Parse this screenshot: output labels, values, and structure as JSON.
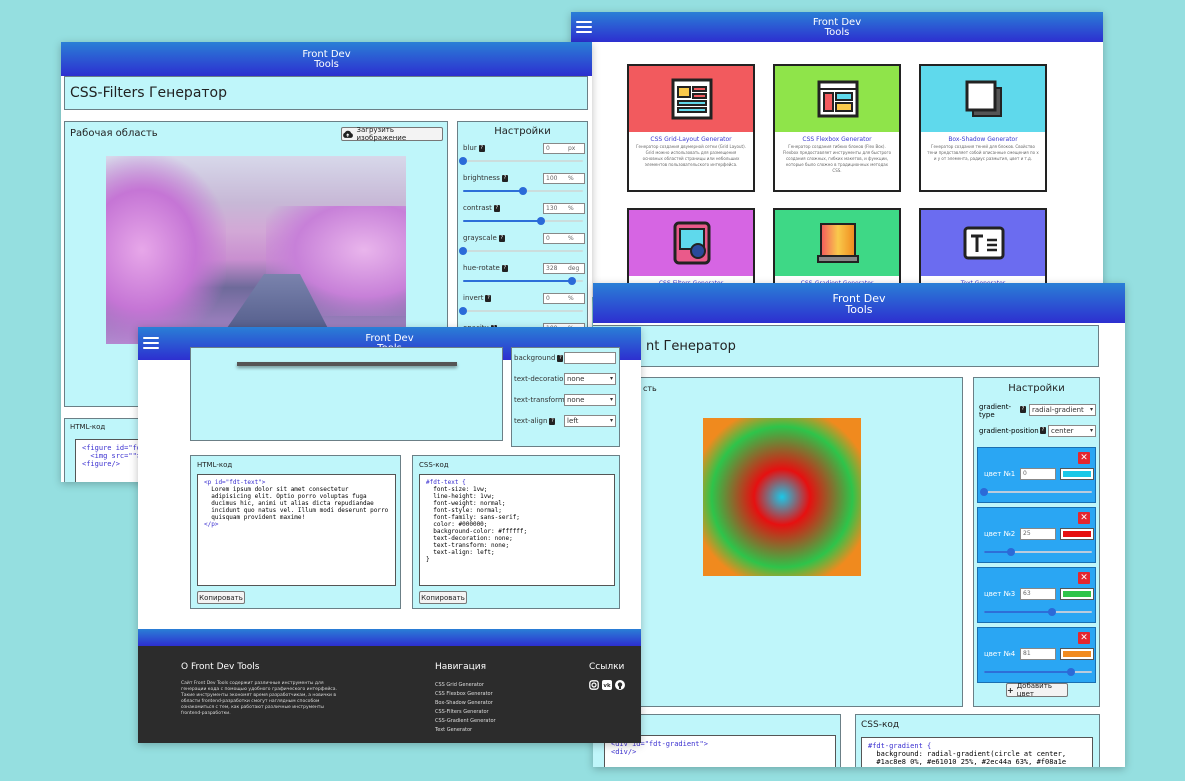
{
  "brand": {
    "line1": "Front Dev",
    "line2": "Tools"
  },
  "filters_window": {
    "page_title": "CSS-Filters Генератор",
    "work_area_label": "Рабочая область",
    "upload_button": "Загрузить изображение",
    "settings_title": "Настройки",
    "settings": [
      {
        "label": "blur",
        "value": "0",
        "unit": "px",
        "fraction": 0.0
      },
      {
        "label": "brightness",
        "value": "100",
        "unit": "%",
        "fraction": 0.5
      },
      {
        "label": "contrast",
        "value": "130",
        "unit": "%",
        "fraction": 0.65
      },
      {
        "label": "grayscale",
        "value": "0",
        "unit": "%",
        "fraction": 0.0
      },
      {
        "label": "hue-rotate",
        "value": "328",
        "unit": "deg",
        "fraction": 0.91
      },
      {
        "label": "invert",
        "value": "0",
        "unit": "%",
        "fraction": 0.0
      },
      {
        "label": "opacity",
        "value": "100",
        "unit": "%",
        "fraction": 1.0
      }
    ],
    "html_label": "HTML-код",
    "html_code": [
      "<figure id=\"fdt",
      "  <img src=\"\">",
      "<figure/>"
    ]
  },
  "home_window": {
    "cards": [
      {
        "title": "CSS Grid-Layout Generator",
        "desc": "Генератор создания двумерной сетки (Grid Layout). Grid можно использовать для размещения основных областей страницы или небольших элементов пользовательского интерфейса.",
        "color": "#f25a5e",
        "icon": "grid-layout-icon"
      },
      {
        "title": "CSS Flexbox Generator",
        "desc": "Генератор создания гибких блоков (Flex Box). Flexbox предоставляет инструменты для быстрого создания сложных, гибких макетов, и функции, которые было сложно в традиционных методах CSS.",
        "color": "#8fe44a",
        "icon": "flexbox-icon"
      },
      {
        "title": "Box-Shadow Generator",
        "desc": "Генератор создания теней для блоков. Свойство тени представляет собой описанные смещения по x и y от элемента, радиус размытия, цвет и т.д.",
        "color": "#5fd9ec",
        "icon": "box-shadow-icon"
      },
      {
        "title": "CSS-Filters Generator",
        "desc": "",
        "color": "#d665e3",
        "icon": "filters-icon"
      },
      {
        "title": "CSS-Gradient Generator",
        "desc": "",
        "color": "#3ed886",
        "icon": "gradient-icon"
      },
      {
        "title": "Text Generator",
        "desc": "",
        "color": "#6b6cf0",
        "icon": "text-icon"
      }
    ]
  },
  "text_window": {
    "settings": [
      {
        "label": "background",
        "value": ""
      },
      {
        "label": "text-decoration",
        "value": "none"
      },
      {
        "label": "text-transform",
        "value": "none"
      },
      {
        "label": "text-align",
        "value": "left"
      }
    ],
    "html_label": "HTML-код",
    "html_code": [
      "<p id=\"fdt-text\">",
      "  Lorem ipsum dolor sit amet consectetur",
      "  adipisicing elit. Optio porro voluptas fuga",
      "  ducimus hic, animi ut alias dicta repudiandae",
      "  incidunt quo natus vel. Illum modi deserunt porro",
      "  quisquam provident maxime!",
      "</p>"
    ],
    "css_label": "CSS-код",
    "css_code": [
      "#fdt-text {",
      "  font-size: 1vw;",
      "  line-height: 1vw;",
      "  font-weight: normal;",
      "  font-style: normal;",
      "  font-family: sans-serif;",
      "  color: #000000;",
      "  background-color: #ffffff;",
      "  text-decoration: none;",
      "  text-transform: none;",
      "  text-align: left;",
      "}"
    ],
    "copy_button": "Копировать",
    "footer": {
      "about_title": "О Front Dev Tools",
      "about_text": "Сайт Front Dev Tools содержит различные инструменты для генерации кода с помощью удобного графического интерфейса. Такие инструменты экономят время разработчикам, а новички в области frontend-разработки смогут наглядным способом ознакомиться с тем, как работают различные инструменты frontend-разработки.",
      "nav_title": "Навигация",
      "nav_items": [
        "CSS Grid Generator",
        "CSS Flexbox Generator",
        "Box-Shadow Generator",
        "CSS-Filters Generator",
        "CSS-Gradient Generator",
        "Text Generator"
      ],
      "links_title": "Ссылки"
    }
  },
  "gradient_window": {
    "page_title": "nt Генератор",
    "work_area_label": "сть",
    "settings_title": "Настройки",
    "gradient_type_label": "gradient-type",
    "gradient_type_value": "radial-gradient",
    "gradient_position_label": "gradient-position",
    "gradient_position_value": "center",
    "colors": [
      {
        "label": "цвет №1",
        "value": "0",
        "color": "#1ac8e8",
        "fraction": 0.0
      },
      {
        "label": "цвет №2",
        "value": "25",
        "color": "#e61010",
        "fraction": 0.25
      },
      {
        "label": "цвет №3",
        "value": "63",
        "color": "#2ec44a",
        "fraction": 0.63
      },
      {
        "label": "цвет №4",
        "value": "81",
        "color": "#f08a1e",
        "fraction": 0.81
      }
    ],
    "add_color_button": "Добавить цвет",
    "html_code": [
      "<div id=\"fdt-gradient\">",
      "",
      "<div/>"
    ],
    "css_label": "CSS-код",
    "css_code": [
      "#fdt-gradient {",
      "  background: radial-gradient(circle at center,",
      "  #1ac8e8 0%, #e61010 25%, #2ec44a 63%, #f08a1e"
    ]
  }
}
